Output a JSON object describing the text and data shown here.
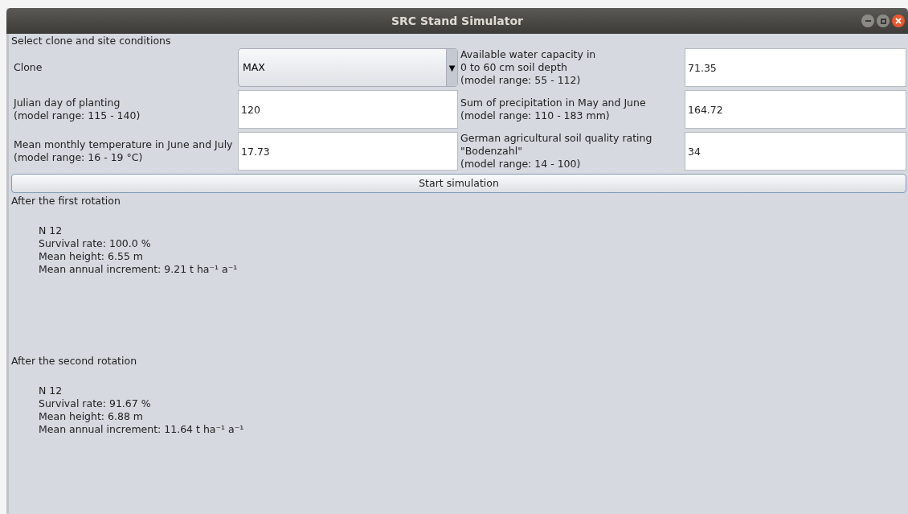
{
  "window": {
    "title": "SRC Stand Simulator"
  },
  "section_title": "Select clone and site conditions",
  "rows": [
    {
      "fields": [
        {
          "kind": "dropdown",
          "label_lines": [
            "Clone"
          ],
          "value": "MAX",
          "caret": "▼"
        },
        {
          "kind": "text",
          "label_lines": [
            "Available water capacity in",
            "0 to 60 cm soil depth",
            "(model range: 55 - 112)"
          ],
          "value": "71.35"
        }
      ]
    },
    {
      "fields": [
        {
          "kind": "text",
          "label_lines": [
            "Julian day of planting",
            "(model range: 115 - 140)"
          ],
          "value": "120"
        },
        {
          "kind": "text",
          "label_lines": [
            "Sum of precipitation in May and June",
            "(model range: 110 - 183 mm)"
          ],
          "value": "164.72"
        }
      ]
    },
    {
      "fields": [
        {
          "kind": "text",
          "label_lines": [
            "Mean monthly temperature in June and July",
            "(model range: 16 - 19 °C)"
          ],
          "value": "17.73"
        },
        {
          "kind": "text",
          "label_lines": [
            "German agricultural soil quality rating",
            "\"Bodenzahl\"",
            "(model range: 14 - 100)"
          ],
          "value": "34"
        }
      ]
    }
  ],
  "start_button": "Start simulation",
  "results": [
    {
      "heading": "After the first rotation",
      "lines": [
        "N 12",
        "Survival rate: 100.0 %",
        "Mean height: 6.55 m",
        "Mean annual increment: 9.21 t ha⁻¹ a⁻¹"
      ]
    },
    {
      "heading": "After the second rotation",
      "lines": [
        "N 12",
        "Survival rate: 91.67 %",
        "Mean height: 6.88 m",
        "Mean annual increment: 11.64 t ha⁻¹ a⁻¹"
      ]
    }
  ]
}
